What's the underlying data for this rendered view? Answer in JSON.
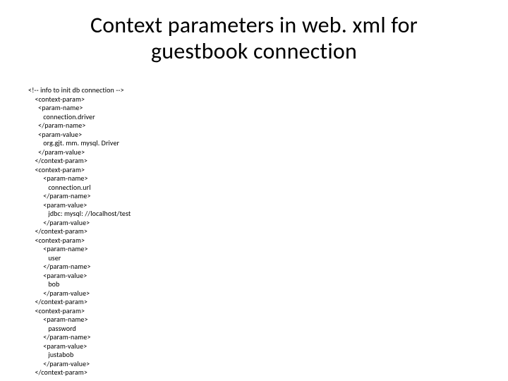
{
  "title": "Context parameters in web. xml for guestbook connection",
  "code": "<!-- info to init db connection -->\n    <context-param>\n      <param-name>\n         connection.driver\n      </param-name>\n      <param-value>\n         org.gjt. mm. mysql. Driver\n      </param-value>\n    </context-param>\n    <context-param>\n         <param-name>\n            connection.url\n         </param-name>\n         <param-value>\n            jdbc: mysql: //localhost/test\n         </param-value>\n    </context-param>\n    <context-param>\n         <param-name>\n            user\n         </param-name>\n         <param-value>\n            bob\n         </param-value>\n    </context-param>\n    <context-param>\n         <param-name>\n            password\n         </param-name>\n         <param-value>\n            justabob\n         </param-value>\n    </context-param>"
}
